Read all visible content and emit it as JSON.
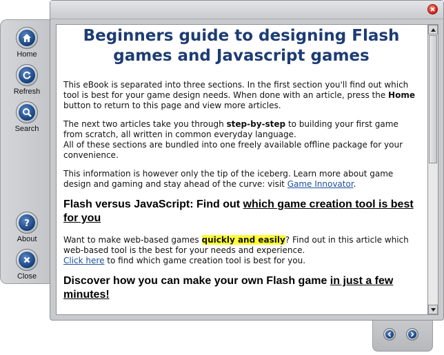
{
  "sidebar": {
    "buttons": [
      {
        "label": "Home",
        "icon": "home-icon"
      },
      {
        "label": "Refresh",
        "icon": "refresh-icon"
      },
      {
        "label": "Search",
        "icon": "search-icon"
      },
      {
        "label": "About",
        "icon": "question-icon"
      },
      {
        "label": "Close",
        "icon": "close-icon"
      }
    ]
  },
  "colors": {
    "title_blue": "#1d3c74",
    "link_blue": "#1c4fa0",
    "highlight": "#ffff33",
    "close_red": "#d41a10",
    "panel_gray": "#c8cacd"
  },
  "article": {
    "title": "Beginners guide to designing Flash games and Javascript games",
    "p1_a": "This eBook is separated into three sections. In the first section you'll find out which tool is best for your game design needs. When done with an article, press the ",
    "p1_bold": "Home",
    "p1_b": " button to return to this page and view more articles.",
    "p2_a": "The next two articles take you through ",
    "p2_bold": "step-by-step",
    "p2_b": " to building your first game from scratch, all written in common everyday language.",
    "p2_c": "All of these sections are bundled into one freely available offline package for your convenience.",
    "p3_a": "This information is however only the tip of the iceberg. Learn more about game design and gaming and stay ahead of the curve: visit ",
    "p3_link": "Game Innovator",
    "p3_b": ".",
    "h2a_plain": "Flash versus JavaScript: Find out ",
    "h2a_underlined": "which game creation tool is best for you",
    "p4_a": "Want to make web-based games ",
    "p4_highlight": "quickly and easily",
    "p4_b": "? Find out in this article which web-based tool is the best for your needs and experience.",
    "p4_link": "Click here",
    "p4_c": " to find which game creation tool is best for you.",
    "h2b_plain": "Discover how you can make your own Flash game ",
    "h2b_underlined": "in just a few minutes!"
  }
}
